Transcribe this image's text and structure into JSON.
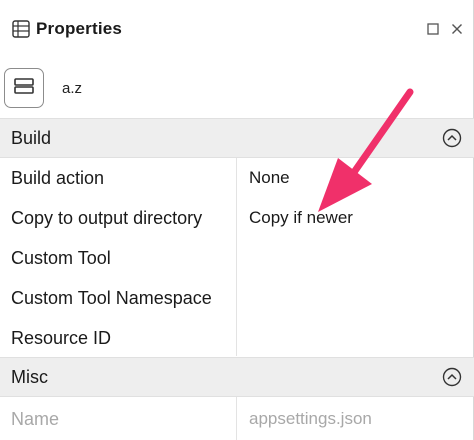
{
  "window": {
    "title": "Properties",
    "icons": {
      "panel": "properties-list-icon",
      "maximize": "maximize-icon",
      "close": "close-icon"
    }
  },
  "object": {
    "name": "a.z",
    "button_icon": "property-pages-icon"
  },
  "sections": {
    "build": {
      "title": "Build",
      "rows": [
        {
          "label": "Build action",
          "value": "None"
        },
        {
          "label": "Copy to output directory",
          "value": "Copy if newer"
        },
        {
          "label": "Custom Tool",
          "value": ""
        },
        {
          "label": "Custom Tool Namespace",
          "value": ""
        },
        {
          "label": "Resource ID",
          "value": ""
        }
      ]
    },
    "misc": {
      "title": "Misc",
      "rows": [
        {
          "label": "Name",
          "value": "appsettings.json"
        }
      ]
    }
  },
  "colors": {
    "accent_arrow": "#f0306a",
    "section_bg": "#eeeeee",
    "dim_text": "#a8a8a8"
  }
}
